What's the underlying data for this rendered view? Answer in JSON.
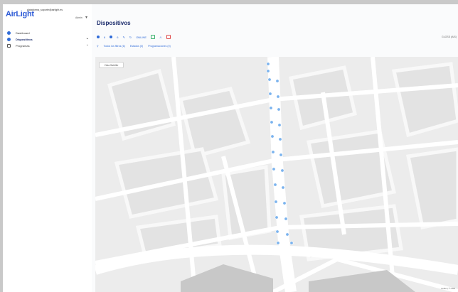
{
  "brand": {
    "logo_text": "AirLight"
  },
  "user": {
    "email": "plataforma_soporte@airlight.es",
    "role": "Admin"
  },
  "sidebar": {
    "items": [
      {
        "label": "Dashboard",
        "icon": "dashboard-icon"
      },
      {
        "label": "Dispositivos",
        "icon": "devices-icon"
      },
      {
        "label": "Programas",
        "icon": "calendar-icon"
      }
    ]
  },
  "main": {
    "title": "Dispositivos",
    "toolbar": {
      "items": [
        "6",
        "6",
        "ONLINE"
      ],
      "right_text": "GLOSS  (AIS)"
    },
    "filters": [
      "Todos los filtros (6)",
      "Estados (0)",
      "Programaciones (0)"
    ],
    "map": {
      "view_button": "Vista Satélite",
      "attribution": "Leaflet | © OSM"
    }
  },
  "colors": {
    "accent": "#2f6bd8",
    "title": "#1a2b6b",
    "marker": "#7ab3ee"
  }
}
